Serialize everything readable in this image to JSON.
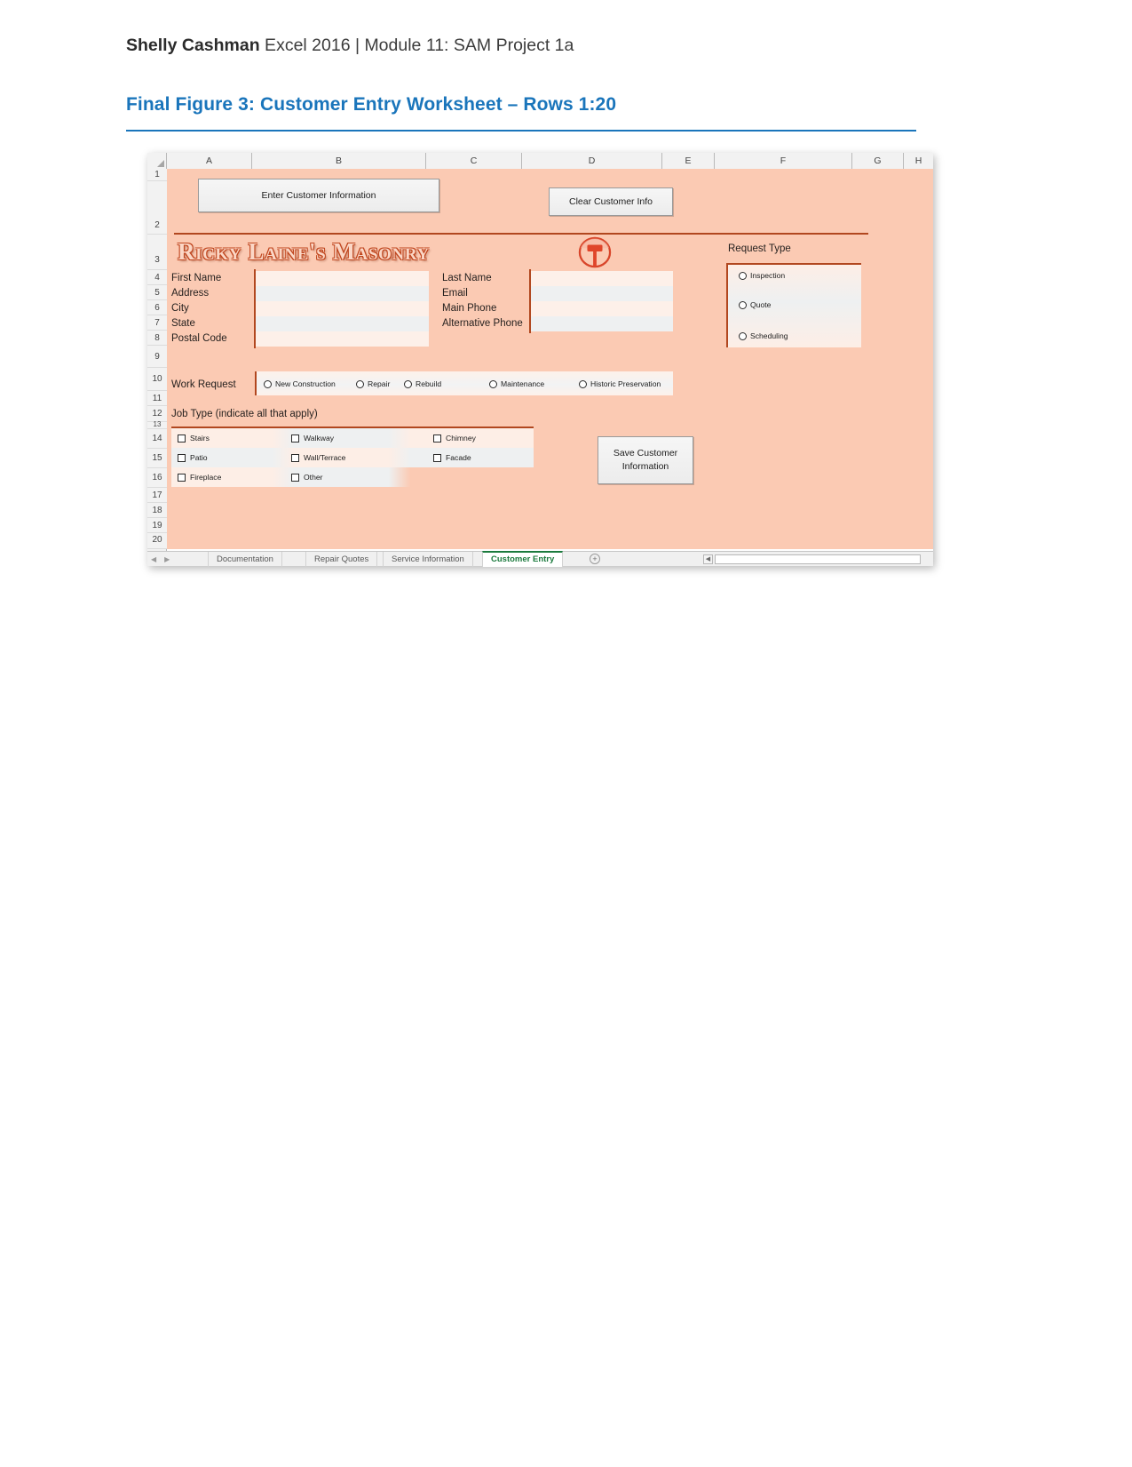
{
  "document": {
    "header_bold": "Shelly Cashman",
    "header_rest": " Excel 2016 | Module 11: SAM Project 1a",
    "figure_title": "Final Figure 3: Customer Entry Worksheet – Rows 1:20",
    "accent_color": "#1a75bb"
  },
  "spreadsheet": {
    "column_headers": [
      "A",
      "B",
      "C",
      "D",
      "E",
      "F",
      "G",
      "H"
    ],
    "row_numbers": [
      "1",
      "2",
      "3",
      "4",
      "5",
      "6",
      "7",
      "8",
      "9",
      "10",
      "11",
      "12",
      "13",
      "14",
      "15",
      "16",
      "17",
      "18",
      "19",
      "20"
    ],
    "fill_color": "#fbcab3",
    "accent_rule_color": "#b1471f"
  },
  "form": {
    "enter_button": "Enter Customer Information",
    "clear_button": "Clear Customer Info",
    "save_button_line1": "Save Customer",
    "save_button_line2": "Information",
    "logo_text": "Ricky Laine's Masonry",
    "logo_icon": "masonry-hammer-icon",
    "left_labels": [
      "First Name",
      "Address",
      "City",
      "State",
      "Postal Code"
    ],
    "right_labels": [
      "Last Name",
      "Email",
      "Main Phone",
      "Alternative Phone"
    ],
    "request_type": {
      "title": "Request Type",
      "options": [
        "Inspection",
        "Quote",
        "Scheduling"
      ]
    },
    "work_request": {
      "title": "Work Request",
      "options": [
        "New Construction",
        "Repair",
        "Rebuild",
        "Maintenance",
        "Historic Preservation"
      ]
    },
    "job_type": {
      "title": "Job Type (indicate all that apply)",
      "column1": [
        "Stairs",
        "Patio",
        "Fireplace"
      ],
      "column2": [
        "Walkway",
        "Wall/Terrace",
        "Other"
      ],
      "column3": [
        "Chimney",
        "Facade"
      ]
    }
  },
  "tabs": {
    "items": [
      {
        "label": "Documentation",
        "active": false
      },
      {
        "label": "Repair Quotes",
        "active": false
      },
      {
        "label": "Service Information",
        "active": false
      },
      {
        "label": "Customer Entry",
        "active": true
      }
    ],
    "add_sheet_icon": "plus-circle-icon"
  }
}
